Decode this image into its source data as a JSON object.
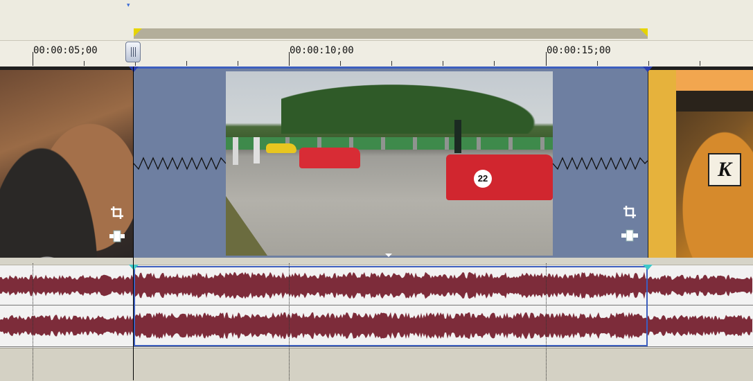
{
  "timeline": {
    "ruler_labels": [
      {
        "text": "00:00:05;00"
      },
      {
        "text": "00:00:10;00"
      },
      {
        "text": "00:00:15;00"
      }
    ]
  },
  "clips": {
    "left": {
      "name": "car-closeup-clip"
    },
    "main": {
      "name": "race-track-clip",
      "car_number": "22"
    },
    "right": {
      "name": "sign-K-clip",
      "sign_letter": "K"
    }
  },
  "colors": {
    "selection": "#3c5ebe",
    "loop_marker": "#e6d400",
    "audio_wave": "#7d2c3a",
    "clip_bg": "#6e7fa1"
  },
  "icons": {
    "crop": "crop-icon",
    "pan": "pan-crop-event-icon"
  }
}
